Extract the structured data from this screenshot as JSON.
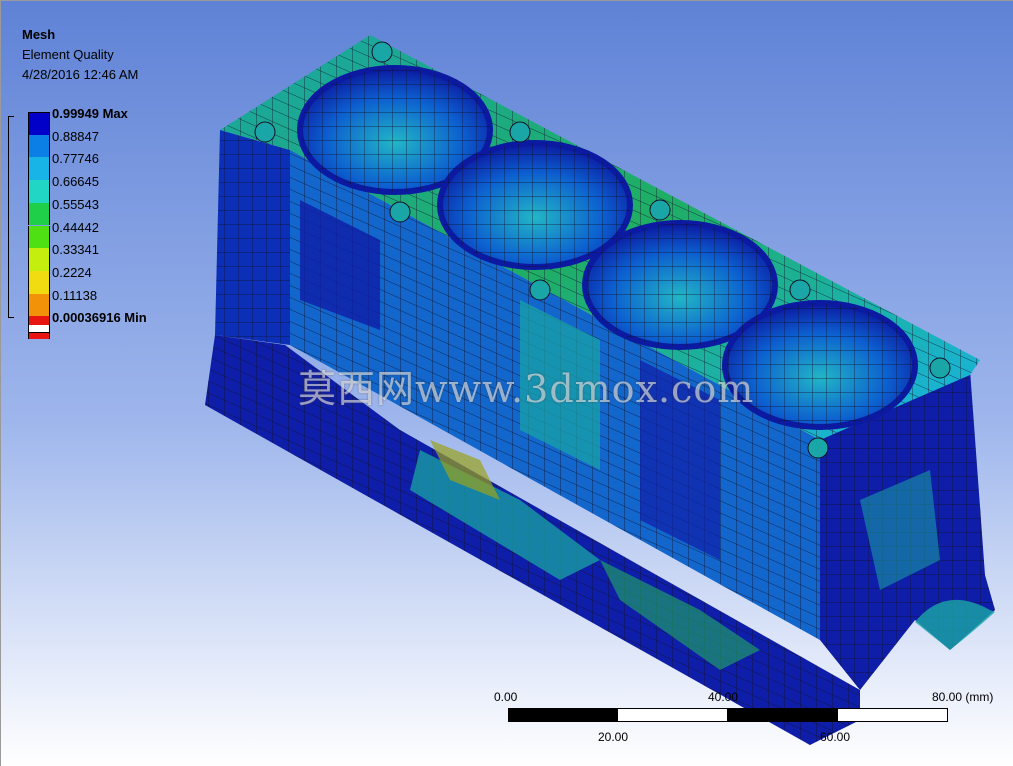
{
  "header": {
    "title": "Mesh",
    "subtitle": "Element Quality",
    "date": "4/28/2016 12:46 AM"
  },
  "legend": {
    "entries": [
      {
        "label": "0.99949 Max",
        "color": "#0000c8",
        "bold": true
      },
      {
        "label": "0.88847",
        "color": "#0c7fe6",
        "bold": false
      },
      {
        "label": "0.77746",
        "color": "#18b4e8",
        "bold": false
      },
      {
        "label": "0.66645",
        "color": "#22d6c6",
        "bold": false
      },
      {
        "label": "0.55543",
        "color": "#1fcf4a",
        "bold": false
      },
      {
        "label": "0.44442",
        "color": "#4fe013",
        "bold": false
      },
      {
        "label": "0.33341",
        "color": "#c4ee0d",
        "bold": false
      },
      {
        "label": "0.2224",
        "color": "#f0dc10",
        "bold": false
      },
      {
        "label": "0.11138",
        "color": "#f29208",
        "bold": false
      },
      {
        "label": "0.00036916 Min",
        "color": "#e81610",
        "bold": true
      }
    ],
    "bottom_color": "#ffffff"
  },
  "watermark": "莫西网www.3dmox.com",
  "scale_bar": {
    "top_labels": [
      "0.00",
      "40.00",
      "80.00 (mm)"
    ],
    "bottom_labels": [
      "20.00",
      "60.00"
    ]
  },
  "colors": {
    "background_top": "#5f82d6",
    "background_bottom": "#ffffff",
    "mesh_dark": "#0f1ea8",
    "mesh_blue": "#0c7fe6",
    "mesh_teal": "#1aa6a6",
    "mesh_green": "#1fae64",
    "mesh_olive": "#9aa21c",
    "mesh_lines": "#101028"
  }
}
